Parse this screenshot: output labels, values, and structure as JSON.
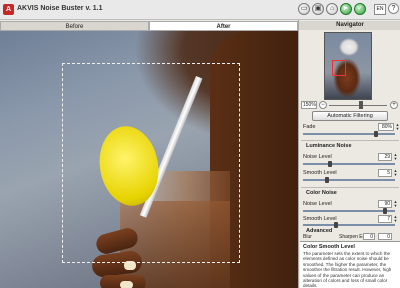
{
  "app": {
    "title": "AKVIS Noise Buster v. 1.1"
  },
  "toolbar": {
    "icons": [
      "folder-icon",
      "save-icon",
      "home-icon",
      "go-icon",
      "info-icon",
      "language-badge",
      "help-icon"
    ],
    "language": "EN",
    "help": "?"
  },
  "tabs": [
    {
      "label": "Before"
    },
    {
      "label": "After"
    }
  ],
  "navigator": {
    "title": "Navigator",
    "zoom": "150%"
  },
  "buttons": {
    "auto_filter": "Automatic Filtering"
  },
  "params": {
    "fade": {
      "label": "Fade",
      "value": "80%",
      "level": 0.8
    },
    "luminance": {
      "title": "Luminance Noise",
      "noise_level": {
        "label": "Noise Level",
        "value": "29",
        "level": 0.29
      },
      "smooth_level": {
        "label": "Smooth Level",
        "value": "5",
        "level": 0.25
      }
    },
    "color": {
      "title": "Color Noise",
      "noise_level": {
        "label": "Noise Level",
        "value": "90",
        "level": 0.9
      },
      "smooth_level": {
        "label": "Smooth Level",
        "value": "7",
        "level": 0.35
      }
    },
    "advanced": {
      "title": "Advanced",
      "blur": {
        "label": "Blur",
        "value": "0",
        "level": 0.0
      },
      "sharpen": {
        "label": "Sharpen Edges",
        "value": "0",
        "level": 0.0
      }
    }
  },
  "hint": {
    "title": "Color Smooth Level",
    "body": "The parameter sets the extent to which the elements defined as color noise should be smoothed. The higher the parameter, the smoother the filtration result. However, high values of the parameter can produce an alteration of colors and loss of small color details."
  }
}
